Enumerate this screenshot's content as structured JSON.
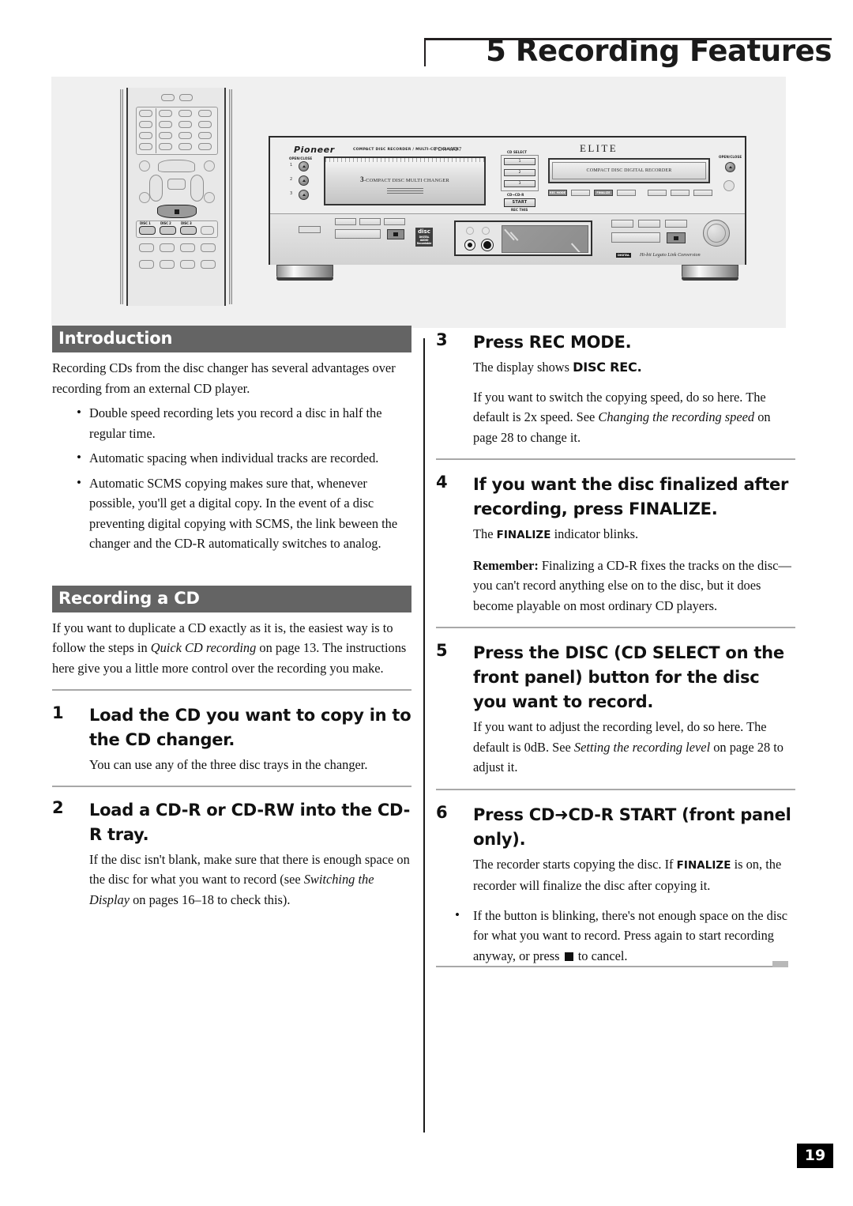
{
  "header": {
    "chapter_title": "5 Recording Features"
  },
  "illustration": {
    "remote": {
      "disc_buttons": [
        "DISC 1",
        "DISC 2",
        "DISC 3"
      ],
      "stop_icon": "stop-square-icon"
    },
    "unit": {
      "brand": "Pioneer",
      "brand_subtitle": "COMPACT DISC RECORDER / MULTI-CD CHANGER",
      "model": "PDR-W37",
      "elite": "ELITE",
      "open_close_left": "OPEN/CLOSE",
      "open_close_right": "OPEN/CLOSE",
      "tray_numbers": [
        "1",
        "2",
        "3"
      ],
      "changer_tray_prefix": "3",
      "changer_tray_label": "-COMPACT DISC MULTI CHANGER",
      "recorder_tray_label": "COMPACT DISC DIGITAL RECORDER",
      "cd_select_label": "CD SELECT",
      "cd_select_buttons": [
        "1",
        "2",
        "3"
      ],
      "cd_to_cdr_label": "CD→CD-R",
      "start_button": "START",
      "rec_this_label": "REC THIS",
      "rec_mode_button": "REC MODE",
      "finalize_button": "FINALIZE",
      "legato_badge": "DIGITAL",
      "legato_text": "Hi-bit Legato Link Conversion",
      "disc_logo": "disc"
    }
  },
  "left_column": {
    "introduction": {
      "heading": "Introduction",
      "intro_paragraph": "Recording CDs from the disc changer has several advantages over recording from an external CD player.",
      "bullets": [
        "Double speed recording lets you record a disc in half the regular time.",
        "Automatic spacing when individual tracks are recorded.",
        "Automatic SCMS copying makes sure that, whenever possible, you'll get a digital copy. In the event of a disc preventing digital copying with SCMS, the link beween the changer and the CD-R automatically switches to analog."
      ]
    },
    "recording_a_cd": {
      "heading": "Recording a CD",
      "intro_paragraph_a": "If you want to duplicate a CD exactly as it is, the easiest way is to follow the steps in ",
      "intro_italic": "Quick CD recording",
      "intro_paragraph_b": " on page 13. The instructions here give you a little more control over the recording you make."
    },
    "steps": [
      {
        "num": "1",
        "title": "Load the CD you want to copy in to the CD changer.",
        "body": "You can use any of the three disc trays in the changer."
      },
      {
        "num": "2",
        "title": "Load a CD-R or CD-RW into the CD-R tray.",
        "body_a": "If the disc isn't blank, make sure that there is enough space on the disc for what you want to record (see ",
        "body_italic": "Switching the Display",
        "body_b": " on pages 16–18 to check this)."
      }
    ]
  },
  "right_column": {
    "steps": [
      {
        "num": "3",
        "title": "Press REC MODE.",
        "body_a": "The display shows ",
        "body_bold": "DISC REC.",
        "body2_a": "If you want to switch the copying speed, do so here. The default is 2x speed. See ",
        "body2_italic": "Changing the recording speed",
        "body2_b": " on page 28 to change it."
      },
      {
        "num": "4",
        "title": "If you want the disc finalized after recording, press FINALIZE.",
        "body_a": "The ",
        "body_bold": "FINALIZE",
        "body_b": " indicator blinks.",
        "body2_bold": "Remember:",
        "body2_text": " Finalizing a CD-R fixes the tracks on the disc—you can't record anything else on to the disc, but it does become playable on most ordinary CD players."
      },
      {
        "num": "5",
        "title": "Press the DISC (CD SELECT on the front panel) button for the disc you want to record.",
        "body_a": "If you want to adjust the recording level, do so here. The default is 0dB. See ",
        "body_italic": "Setting the recording level",
        "body_b": " on page 28 to adjust it."
      },
      {
        "num": "6",
        "title_a": "Press CD",
        "title_arrow": "➜",
        "title_b": "CD-R START (front panel only).",
        "body_a": "The recorder starts copying the disc. If ",
        "body_bold": "FINALIZE",
        "body_b": " is on, the recorder will finalize the disc after copying it.",
        "bullet_a": "If the button is blinking, there's not enough space on the disc for what you want to record. Press again to start recording anyway, or press ",
        "bullet_b": " to cancel."
      }
    ]
  },
  "footer": {
    "page_number": "19"
  }
}
